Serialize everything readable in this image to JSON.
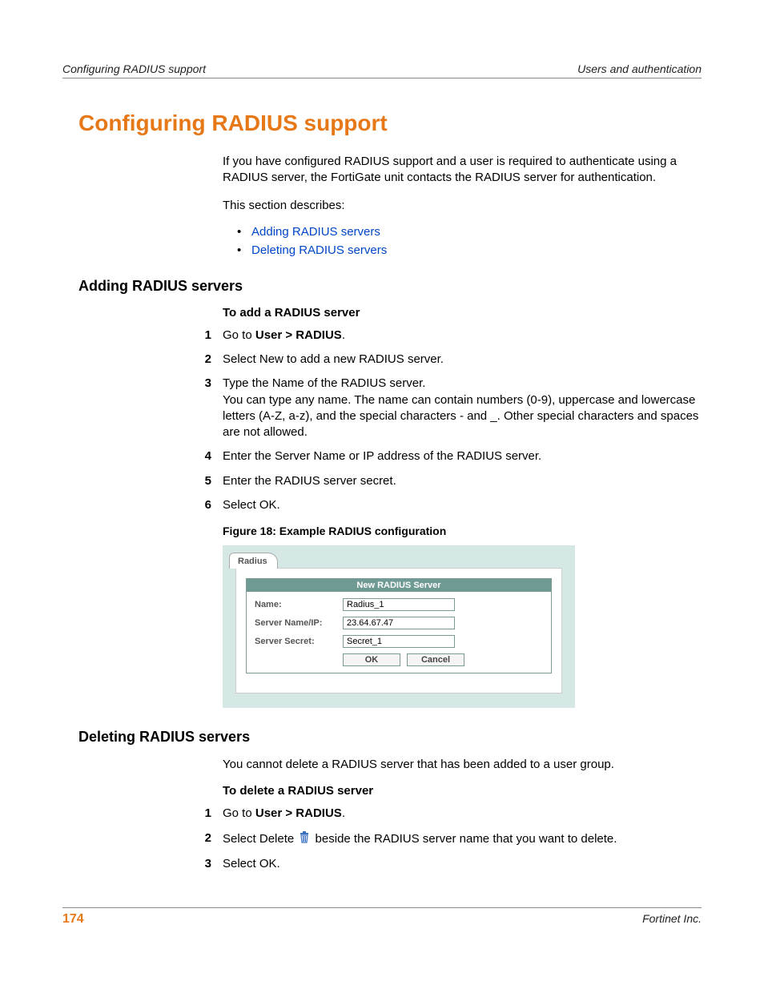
{
  "header": {
    "left": "Configuring RADIUS support",
    "right": "Users and authentication"
  },
  "title": "Configuring RADIUS support",
  "intro_p1": "If you have configured RADIUS support and a user is required to authenticate using a RADIUS server, the FortiGate unit contacts the RADIUS server for authentication.",
  "intro_p2": "This section describes:",
  "toc": {
    "item1": "Adding RADIUS servers",
    "item2": "Deleting RADIUS servers"
  },
  "section_add": {
    "heading": "Adding RADIUS servers",
    "proc_title": "To add a RADIUS server",
    "steps": {
      "s1_a": "Go to ",
      "s1_b": "User > RADIUS",
      "s1_c": ".",
      "s2": "Select New to add a new RADIUS server.",
      "s3_a": "Type the Name of the RADIUS server.",
      "s3_b": "You can type any name. The name can contain numbers (0-9), uppercase and lowercase letters (A-Z, a-z), and the special characters - and _. Other special characters and spaces are not allowed.",
      "s4": "Enter the Server Name or IP address of the RADIUS server.",
      "s5": "Enter the RADIUS server secret.",
      "s6": "Select OK."
    },
    "fig_caption": "Figure 18: Example RADIUS configuration",
    "figure": {
      "tab": "Radius",
      "panel_title": "New RADIUS Server",
      "fields": {
        "name_label": "Name:",
        "name_value": "Radius_1",
        "ip_label": "Server Name/IP:",
        "ip_value": "23.64.67.47",
        "secret_label": "Server Secret:",
        "secret_value": "Secret_1"
      },
      "ok": "OK",
      "cancel": "Cancel"
    }
  },
  "section_del": {
    "heading": "Deleting RADIUS servers",
    "intro": "You cannot delete a RADIUS server that has been added to a user group.",
    "proc_title": "To delete a RADIUS server",
    "steps": {
      "s1_a": "Go to ",
      "s1_b": "User > RADIUS",
      "s1_c": ".",
      "s2_a": "Select Delete ",
      "s2_b": " beside the RADIUS server name that you want to delete.",
      "s3": "Select OK."
    }
  },
  "footer": {
    "page": "174",
    "company": "Fortinet Inc."
  }
}
